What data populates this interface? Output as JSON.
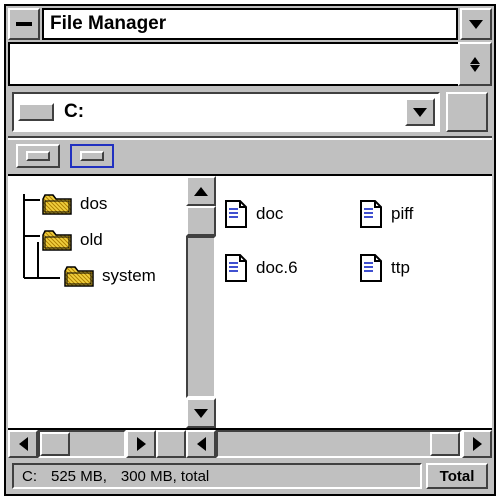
{
  "title": "File Manager",
  "drive": {
    "label": "C:"
  },
  "tree": [
    {
      "name": "dos"
    },
    {
      "name": "old"
    },
    {
      "name": "system",
      "indent": true
    }
  ],
  "files": [
    {
      "name": "doc"
    },
    {
      "name": "piff"
    },
    {
      "name": "doc.6"
    },
    {
      "name": "ttp"
    }
  ],
  "status": {
    "drive": "C:",
    "size": "525 MB,",
    "free": "300 MB, total",
    "button": "Total"
  }
}
